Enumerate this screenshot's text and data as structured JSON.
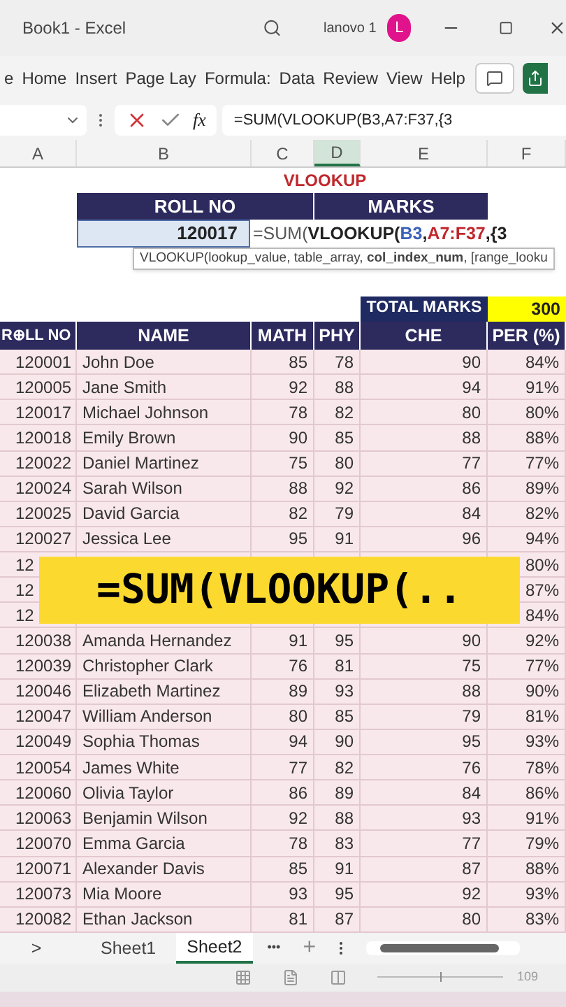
{
  "window": {
    "title": "Book1 - Excel",
    "user": "lanovo 1",
    "avatar": "L"
  },
  "ribbon_tabs": [
    {
      "label": "e",
      "selected": false
    },
    {
      "label": "Home",
      "selected": false
    },
    {
      "label": "Insert",
      "selected": false
    },
    {
      "label": "Page Lay",
      "selected": false
    },
    {
      "label": "Formula:",
      "selected": false
    },
    {
      "label": "Data",
      "selected": false
    },
    {
      "label": "Review",
      "selected": false
    },
    {
      "label": "View",
      "selected": false
    },
    {
      "label": "Help",
      "selected": false
    }
  ],
  "formula_bar": {
    "function_label": "fx",
    "value": "=SUM(VLOOKUP(B3,A7:F37,{3"
  },
  "columns": [
    {
      "label": "A",
      "selected": false
    },
    {
      "label": "B",
      "selected": false
    },
    {
      "label": "C",
      "selected": false
    },
    {
      "label": "D",
      "selected": true
    },
    {
      "label": "E",
      "selected": false
    },
    {
      "label": "F",
      "selected": false
    }
  ],
  "title": "VLOOKUP",
  "lookup": {
    "roll_header": "ROLL NO",
    "marks_header": "MARKS",
    "roll_value": "120017",
    "formula_parts": [
      "=SUM(",
      "VLOOKUP(",
      "B3",
      ",",
      "A7:F37",
      ",{3"
    ],
    "tooltip": "VLOOKUP(lookup_value, table_array, **col_index_num**, [range_looku"
  },
  "total": {
    "label": "TOTAL MARKS",
    "value": "300"
  },
  "table": {
    "columns": [
      "R⊕LL NO",
      "NAME",
      "MATH",
      "PHY",
      "CHE",
      "PER (%)"
    ],
    "rows": [
      [
        "120001",
        "John Doe",
        "85",
        "78",
        "90",
        "84%"
      ],
      [
        "120005",
        "Jane Smith",
        "92",
        "88",
        "94",
        "91%"
      ],
      [
        "120017",
        "Michael Johnson",
        "78",
        "82",
        "80",
        "80%"
      ],
      [
        "120018",
        "Emily Brown",
        "90",
        "85",
        "88",
        "88%"
      ],
      [
        "120022",
        "Daniel Martinez",
        "75",
        "80",
        "77",
        "77%"
      ],
      [
        "120024",
        "Sarah Wilson",
        "88",
        "92",
        "86",
        "89%"
      ],
      [
        "120025",
        "David Garcia",
        "82",
        "79",
        "84",
        "82%"
      ],
      [
        "120027",
        "Jessica Lee",
        "95",
        "91",
        "96",
        "94%"
      ],
      [
        "12",
        "",
        "",
        "",
        "",
        "80%"
      ],
      [
        "12",
        "",
        "",
        "",
        "",
        "87%"
      ],
      [
        "12",
        "",
        "",
        "",
        "",
        "84%"
      ],
      [
        "120038",
        "Amanda Hernandez",
        "91",
        "95",
        "90",
        "92%"
      ],
      [
        "120039",
        "Christopher Clark",
        "76",
        "81",
        "75",
        "77%"
      ],
      [
        "120046",
        "Elizabeth Martinez",
        "89",
        "93",
        "88",
        "90%"
      ],
      [
        "120047",
        "William Anderson",
        "80",
        "85",
        "79",
        "81%"
      ],
      [
        "120049",
        "Sophia Thomas",
        "94",
        "90",
        "95",
        "93%"
      ],
      [
        "120054",
        "James White",
        "77",
        "82",
        "76",
        "78%"
      ],
      [
        "120060",
        "Olivia Taylor",
        "86",
        "89",
        "84",
        "86%"
      ],
      [
        "120063",
        "Benjamin Wilson",
        "92",
        "88",
        "93",
        "91%"
      ],
      [
        "120070",
        "Emma Garcia",
        "78",
        "83",
        "77",
        "79%"
      ],
      [
        "120071",
        "Alexander Davis",
        "85",
        "91",
        "87",
        "88%"
      ],
      [
        "120073",
        "Mia Moore",
        "93",
        "95",
        "92",
        "93%"
      ],
      [
        "120082",
        "Ethan Jackson",
        "81",
        "87",
        "80",
        "83%"
      ]
    ]
  },
  "caption": "=SUM(VLOOKUP(..",
  "sheets": [
    {
      "label": "Sheet1",
      "selected": false
    },
    {
      "label": "Sheet2",
      "selected": true
    }
  ],
  "sheet_more": "•••",
  "sheet_add": "+",
  "nav": ">",
  "zoom": {
    "label": "109",
    "level": 0.5
  }
}
